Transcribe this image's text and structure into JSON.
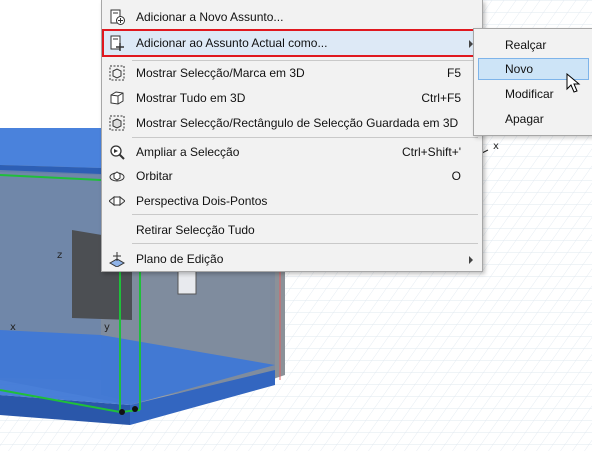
{
  "menu": {
    "items": [
      {
        "label": "Adicionar a Novo Assunto...",
        "icon": "add-to-issue-icon"
      },
      {
        "label": "Adicionar ao Assunto Actual como...",
        "icon": "add-to-current-issue-icon",
        "has_submenu": true,
        "highlighted": true
      },
      {
        "label": "Mostrar Selecção/Marca em 3D",
        "shortcut": "F5",
        "icon": "show-selection-3d-icon"
      },
      {
        "label": "Mostrar Tudo em 3D",
        "shortcut": "Ctrl+F5",
        "icon": "show-all-3d-icon"
      },
      {
        "label": "Mostrar Selecção/Rectângulo de Selecção Guardada em 3D",
        "icon": "show-marquee-3d-icon"
      },
      {
        "label": "Ampliar a Selecção",
        "shortcut": "Ctrl+Shift+'",
        "icon": "zoom-selection-icon"
      },
      {
        "label": "Orbitar",
        "shortcut": "O",
        "icon": "orbit-icon"
      },
      {
        "label": "Perspectiva Dois-Pontos",
        "icon": "two-point-perspective-icon"
      },
      {
        "label": "Retirar Selecção Tudo"
      },
      {
        "label": "Plano de Edição",
        "icon": "editing-plane-icon",
        "has_submenu": true
      }
    ]
  },
  "submenu": {
    "items": [
      {
        "label": "Realçar"
      },
      {
        "label": "Novo",
        "active": true
      },
      {
        "label": "Modificar"
      },
      {
        "label": "Apagar"
      }
    ]
  },
  "viewport": {
    "axis_labels": {
      "x_left": "x",
      "y": "y",
      "z": "z",
      "x_right": "x"
    }
  },
  "colors": {
    "highlight_frame": "#e0181f",
    "menu_background": "#f2f2f2",
    "submenu_active": "#cde4f7",
    "selection_blue": "#3f78d6",
    "selection_green": "#1fbf3a"
  }
}
